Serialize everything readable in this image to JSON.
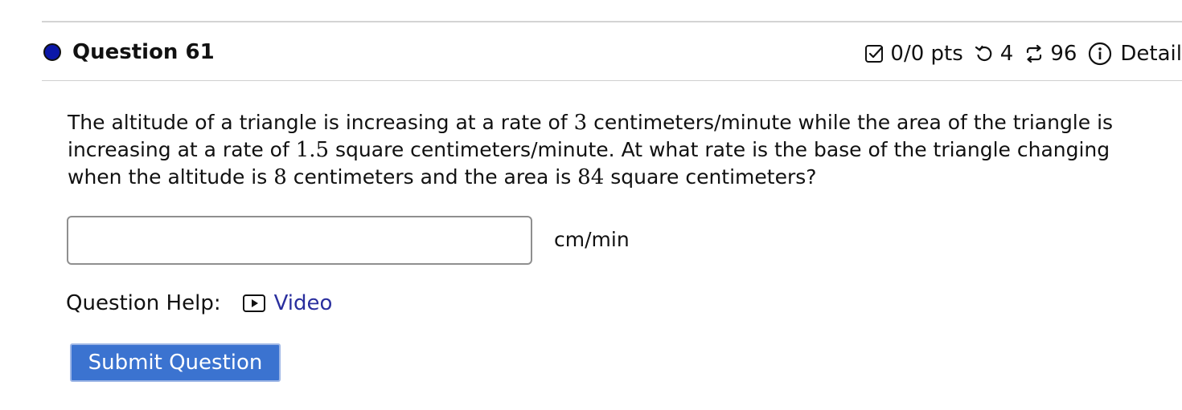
{
  "question": {
    "title": "Question 61",
    "status_color": "#0b17a8",
    "points": "0/0 pts",
    "points_icon": "checkbox-icon",
    "attempts": "4",
    "attempts_icon": "retry-icon",
    "versions": "96",
    "versions_icon": "swap-icon",
    "details_label": "Detail",
    "details_icon": "info-icon",
    "body": {
      "part1": "The altitude of a triangle is increasing at a rate of ",
      "n1": "3",
      "part2": " centimeters/minute while the area of the triangle is increasing at a rate of ",
      "n2": "1.5",
      "part3": " square centimeters/minute. At what rate is the base of the triangle changing when the altitude is ",
      "n3": "8",
      "part4": " centimeters and the area is ",
      "n4": "84",
      "part5": " square centimeters?"
    }
  },
  "answer": {
    "value": "",
    "placeholder": "",
    "unit": "cm/min"
  },
  "help": {
    "label": "Question Help:",
    "video_label": "Video",
    "video_icon": "video-play-icon",
    "link_color": "#2a2f9e"
  },
  "submit": {
    "label": "Submit Question",
    "color": "#3b73d0"
  }
}
